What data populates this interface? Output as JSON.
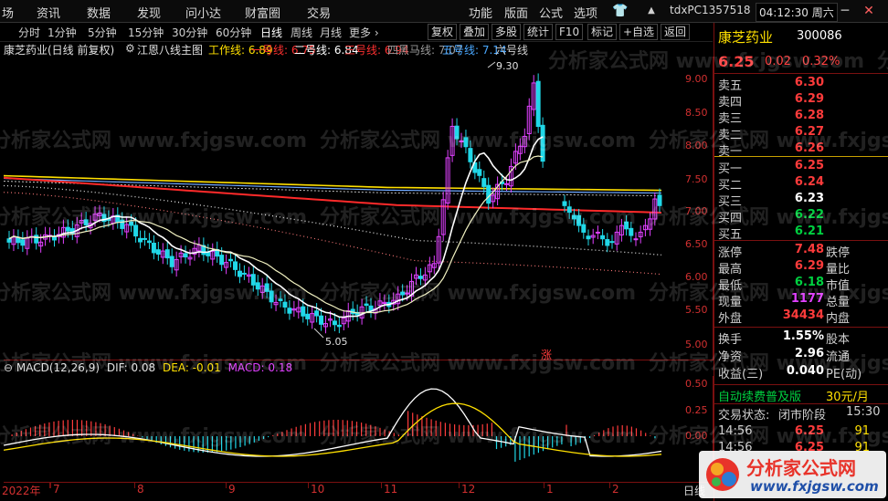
{
  "menubar": {
    "left_items": [
      "场",
      "资讯",
      "数据",
      "发现",
      "问小达",
      "财富圈",
      "交易"
    ],
    "right_items": [
      "功能",
      "版面",
      "公式",
      "选项"
    ],
    "account": "tdxPC1357518",
    "clock": "04:12:30 周六"
  },
  "toolbar": {
    "periods": [
      "分时",
      "1分钟",
      "5分钟",
      "15分钟",
      "30分钟",
      "60分钟",
      "日线",
      "周线",
      "月线",
      "更多 ›"
    ],
    "active_period": "日线",
    "buttons": [
      "复权",
      "叠加",
      "多股",
      "统计",
      "F10",
      "标记",
      "+自选",
      "返回"
    ]
  },
  "infoline": {
    "stock": "康芝药业(日线 前复权)",
    "indicator": "江恩八线主图",
    "lines": [
      {
        "label": "工作线: 6.89",
        "color": "#ffe000"
      },
      {
        "label": "一号线: 6.75",
        "color": "#ff3030"
      },
      {
        "label": "二号线: 6.84",
        "color": "#ffffff"
      },
      {
        "label": "三号线: 6.94",
        "color": "#ff3030"
      },
      {
        "label": "四黑马线: 7.07",
        "color": "#9a9a9a"
      },
      {
        "label": "五号线: 7.14",
        "color": "#4aa8ff"
      },
      {
        "label": "六号线",
        "color": "#d0d0d0"
      }
    ]
  },
  "main_axis": [
    "9.00",
    "8.50",
    "8.00",
    "7.50",
    "7.00",
    "6.50",
    "6.00",
    "5.50",
    "5.00"
  ],
  "annotations": {
    "high": "9.30",
    "low": "5.05",
    "limit_up": "涨"
  },
  "macd_info": {
    "name": "MACD(12,26,9)",
    "dif": "DIF: 0.08",
    "dea": "DEA: -0.01",
    "macd": "MACD: 0.18"
  },
  "macd_axis": [
    "0.50",
    "0.25",
    "0.00"
  ],
  "x_axis": [
    "2022年",
    "7",
    "8",
    "9",
    "10",
    "11",
    "12",
    "1",
    "2"
  ],
  "x_axis_end": "日线",
  "quote": {
    "name": "康芝药业",
    "code": "300086",
    "price": "6.25",
    "change": "0.02",
    "pct": "0.32%",
    "asks": [
      {
        "label": "卖五",
        "price": "6.30",
        "vol": "",
        "color": "#ff3b3b"
      },
      {
        "label": "卖四",
        "price": "6.29",
        "vol": "",
        "color": "#ff3b3b"
      },
      {
        "label": "卖三",
        "price": "6.28",
        "vol": "",
        "color": "#ff3b3b"
      },
      {
        "label": "卖二",
        "price": "6.27",
        "vol": "",
        "color": "#ff3b3b"
      },
      {
        "label": "卖一",
        "price": "6.26",
        "vol": "",
        "color": "#ff3b3b"
      }
    ],
    "bids": [
      {
        "label": "买一",
        "price": "6.25",
        "vol": "",
        "color": "#ff3b3b"
      },
      {
        "label": "买二",
        "price": "6.24",
        "vol": "",
        "color": "#ff3b3b"
      },
      {
        "label": "买三",
        "price": "6.23",
        "vol": "",
        "color": "#ffffff"
      },
      {
        "label": "买四",
        "price": "6.22",
        "vol": "",
        "color": "#00d040"
      },
      {
        "label": "买五",
        "price": "6.21",
        "vol": "",
        "color": "#00d040"
      }
    ],
    "stats": [
      {
        "label": "涨停",
        "value": "7.48",
        "color": "#ff3b3b",
        "label2": "跌停"
      },
      {
        "label": "最高",
        "value": "6.29",
        "color": "#ff3b3b",
        "label2": "量比"
      },
      {
        "label": "最低",
        "value": "6.18",
        "color": "#00d040",
        "label2": "市值"
      },
      {
        "label": "现量",
        "value": "1177",
        "color": "#e040ff",
        "label2": "总量"
      },
      {
        "label": "外盘",
        "value": "34434",
        "color": "#ff3b3b",
        "label2": "内盘"
      }
    ],
    "stats2": [
      {
        "label": "换手",
        "value": "1.55%",
        "color": "#ffffff",
        "label2": "股本"
      },
      {
        "label": "净资",
        "value": "2.96",
        "color": "#ffffff",
        "label2": "流通"
      },
      {
        "label": "收益(三)",
        "value": "0.040",
        "color": "#ffffff",
        "label2": "PE(动)"
      }
    ],
    "promo": "自动续费普及版",
    "promo_price": "30元/月",
    "trade_status_label": "交易状态:",
    "trade_status": "闭市阶段",
    "trade_time": "15:30",
    "ticks": [
      {
        "time": "14:56",
        "price": "6.25",
        "vol": "91"
      },
      {
        "time": "14:56",
        "price": "6.25",
        "vol": "91"
      }
    ]
  },
  "watermark": {
    "text": "分析家公式网 www.fxjgsw.com",
    "brand": "分析家公式网",
    "url": "www.fxjgsw.com"
  }
}
